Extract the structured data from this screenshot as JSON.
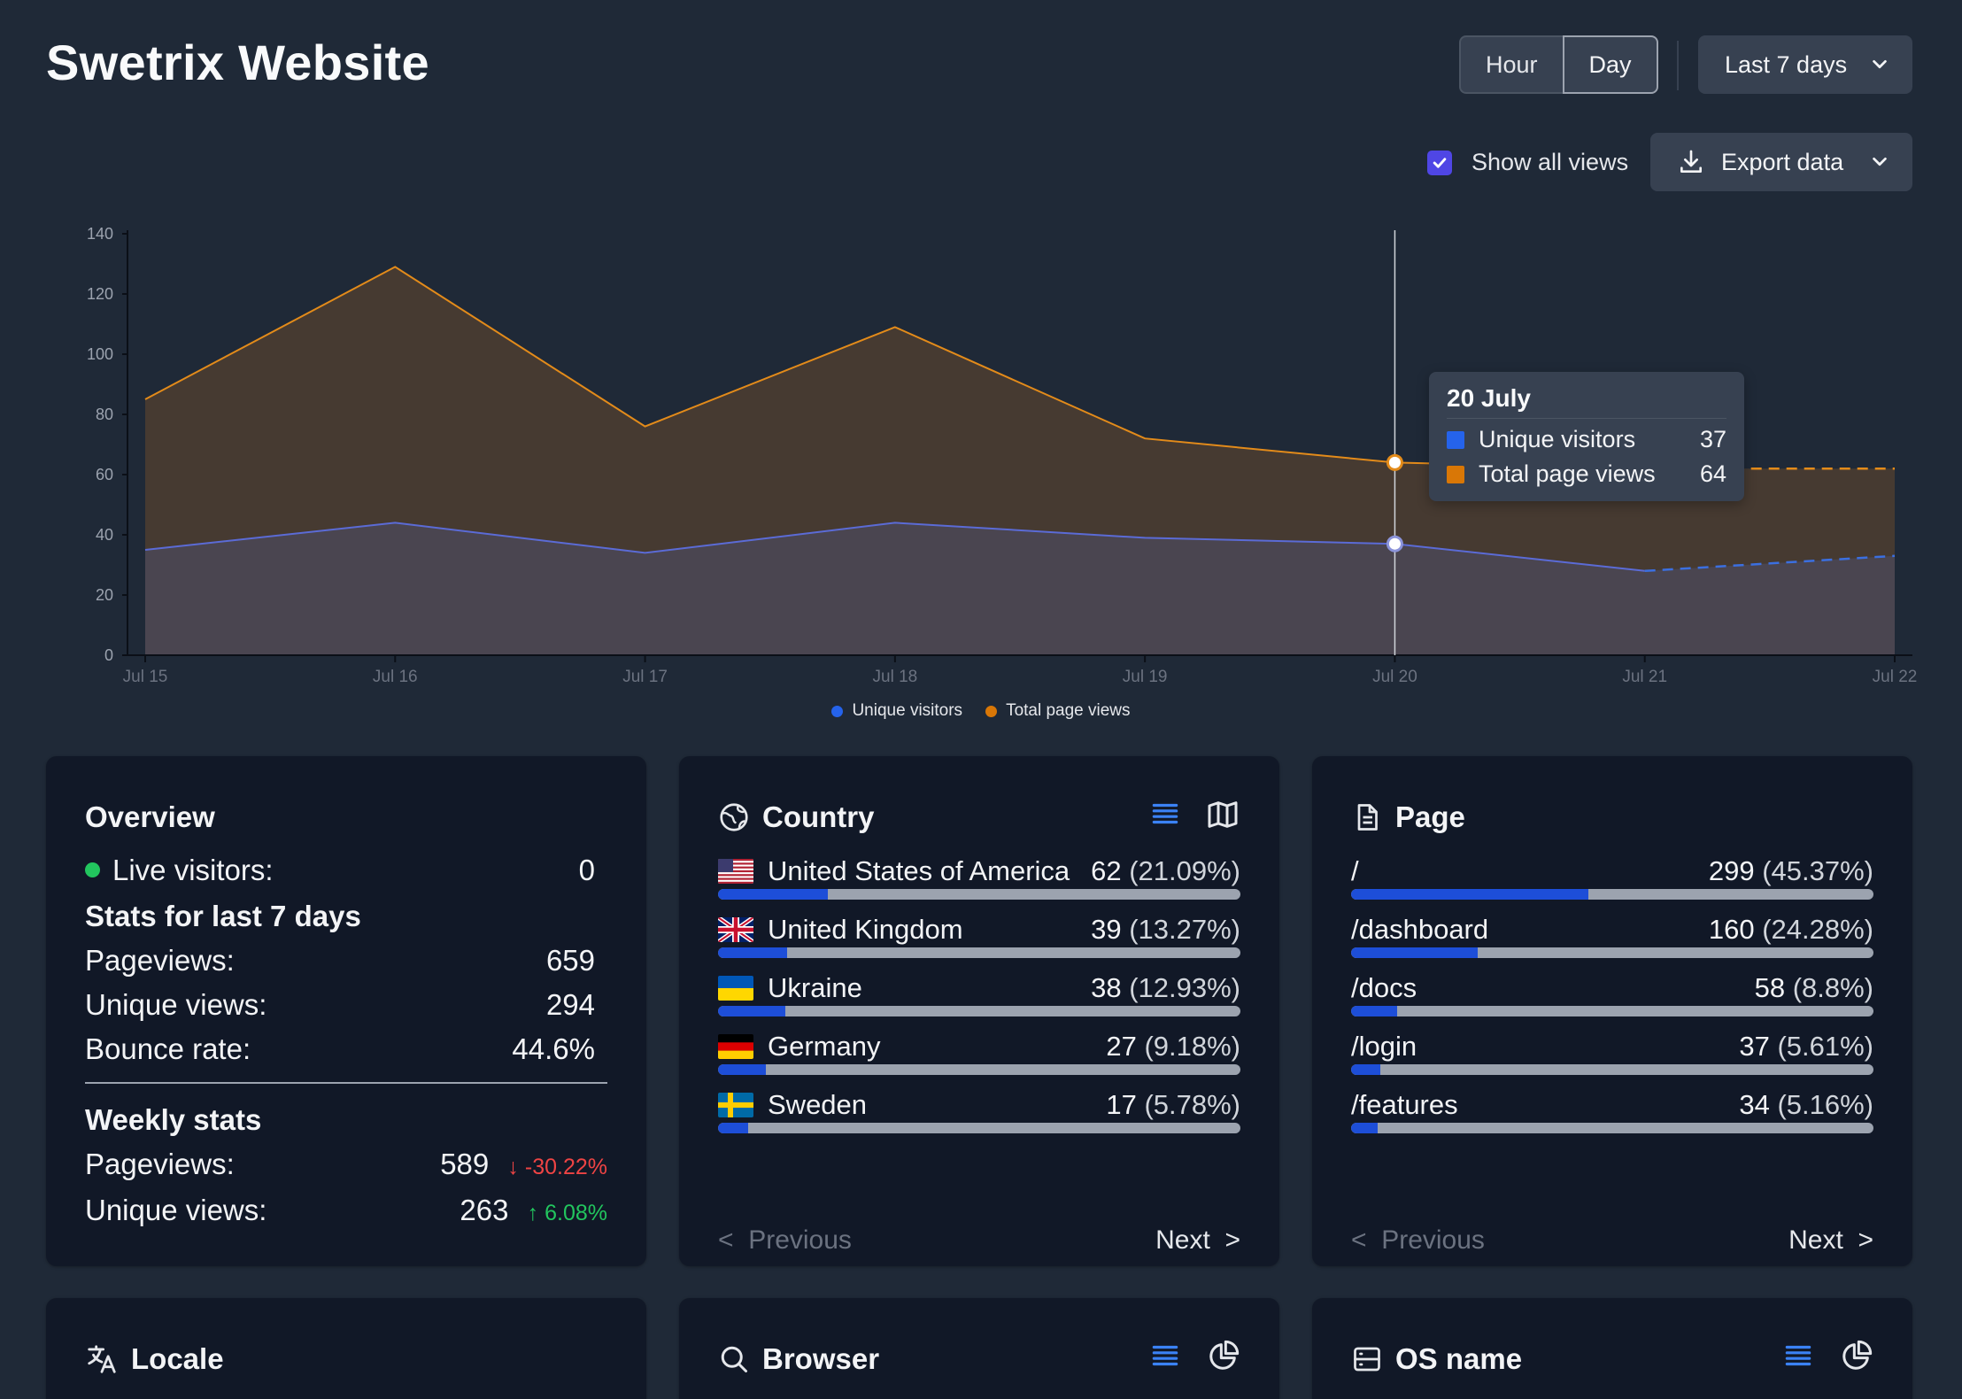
{
  "header": {
    "title": "Swetrix Website",
    "time_bucket": {
      "hour": "Hour",
      "day": "Day",
      "selected": "Day"
    },
    "period": "Last 7 days"
  },
  "controls": {
    "show_all_views": {
      "label": "Show all views",
      "checked": true
    },
    "export": "Export data"
  },
  "chart_data": {
    "type": "area",
    "x": [
      "Jul 15",
      "Jul 16",
      "Jul 17",
      "Jul 18",
      "Jul 19",
      "Jul 20",
      "Jul 21",
      "Jul 22"
    ],
    "series": [
      {
        "name": "Unique visitors",
        "color": "#2563eb",
        "values": [
          35,
          44,
          34,
          44,
          39,
          37,
          28,
          33
        ]
      },
      {
        "name": "Total page views",
        "color": "#d97706",
        "values": [
          85,
          129,
          76,
          109,
          72,
          64,
          62,
          62
        ]
      }
    ],
    "ylim": [
      0,
      140
    ],
    "yticks": [
      0,
      20,
      40,
      60,
      80,
      100,
      120,
      140
    ],
    "projected_from_index": 6,
    "legend": "bottom-center"
  },
  "tooltip": {
    "title": "20 July",
    "rows": [
      {
        "label": "Unique visitors",
        "value": "37",
        "color": "#2563eb"
      },
      {
        "label": "Total page views",
        "value": "64",
        "color": "#d97706"
      }
    ]
  },
  "overview": {
    "title": "Overview",
    "live_label": "Live visitors:",
    "live_value": "0",
    "stats_title": "Stats for last 7 days",
    "pageviews_label": "Pageviews:",
    "pageviews_value": "659",
    "unique_label": "Unique views:",
    "unique_value": "294",
    "bounce_label": "Bounce rate:",
    "bounce_value": "44.6%",
    "weekly_title": "Weekly stats",
    "weekly_pageviews_label": "Pageviews:",
    "weekly_pageviews_value": "589",
    "weekly_pageviews_change": "-30.22%",
    "weekly_unique_label": "Unique views:",
    "weekly_unique_value": "263",
    "weekly_unique_change": "6.08%"
  },
  "country": {
    "title": "Country",
    "items": [
      {
        "flag": "us",
        "name": "United States of America",
        "count": "62",
        "pct": "(21.09%)",
        "share": 0.2109
      },
      {
        "flag": "gb",
        "name": "United Kingdom",
        "count": "39",
        "pct": "(13.27%)",
        "share": 0.1327
      },
      {
        "flag": "ua",
        "name": "Ukraine",
        "count": "38",
        "pct": "(12.93%)",
        "share": 0.1293
      },
      {
        "flag": "de",
        "name": "Germany",
        "count": "27",
        "pct": "(9.18%)",
        "share": 0.0918
      },
      {
        "flag": "se",
        "name": "Sweden",
        "count": "17",
        "pct": "(5.78%)",
        "share": 0.0578
      }
    ],
    "prev": "Previous",
    "next": "Next"
  },
  "page": {
    "title": "Page",
    "items": [
      {
        "name": "/",
        "count": "299",
        "pct": "(45.37%)",
        "share": 0.4537
      },
      {
        "name": "/dashboard",
        "count": "160",
        "pct": "(24.28%)",
        "share": 0.2428
      },
      {
        "name": "/docs",
        "count": "58",
        "pct": "(8.8%)",
        "share": 0.088
      },
      {
        "name": "/login",
        "count": "37",
        "pct": "(5.61%)",
        "share": 0.0561
      },
      {
        "name": "/features",
        "count": "34",
        "pct": "(5.16%)",
        "share": 0.0516
      }
    ],
    "prev": "Previous",
    "next": "Next"
  },
  "bottom_cards": {
    "locale": "Locale",
    "browser": "Browser",
    "os": "OS name"
  },
  "icons": {
    "list": "list-icon",
    "map": "map-icon",
    "pie": "pie-chart-icon",
    "globe": "globe-icon",
    "document": "document-icon",
    "translate": "translate-icon",
    "search": "search-icon",
    "server": "server-icon"
  }
}
